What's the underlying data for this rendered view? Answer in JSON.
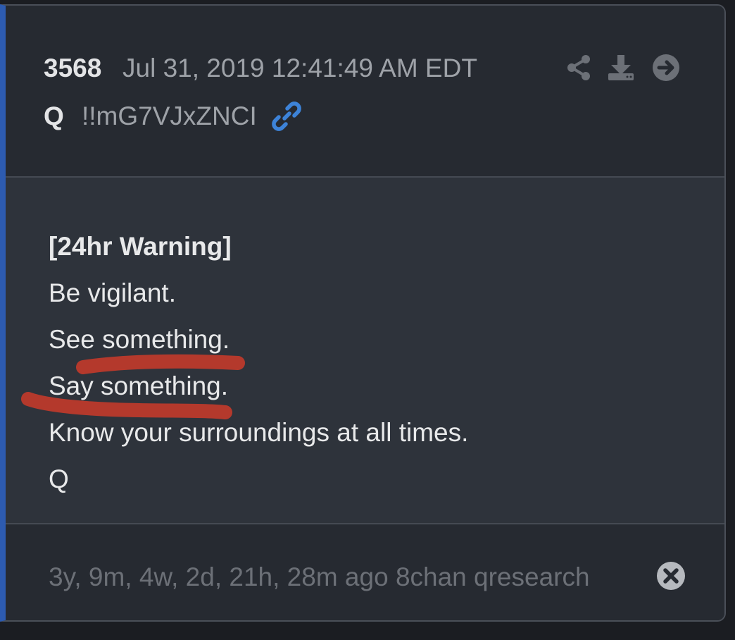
{
  "header": {
    "post_number": "3568",
    "timestamp": "Jul 31, 2019 12:41:49 AM EDT",
    "author": "Q",
    "tripcode": "!!mG7VJxZNCI",
    "icons": [
      "link-icon",
      "share-icon",
      "download-icon",
      "arrow-right-circle-icon"
    ]
  },
  "post": {
    "lines": [
      "[24hr Warning]",
      "Be vigilant.",
      "See something.",
      "Say something.",
      "Know your surroundings at all times.",
      "Q"
    ]
  },
  "footer": {
    "meta": "3y, 9m, 4w, 2d, 21h, 28m ago 8chan qresearch",
    "icons": [
      "close-circle-icon"
    ]
  },
  "colors": {
    "accent_border": "#2d5bb0",
    "link_icon": "#3d83d8",
    "annotation": "#c0392b"
  }
}
